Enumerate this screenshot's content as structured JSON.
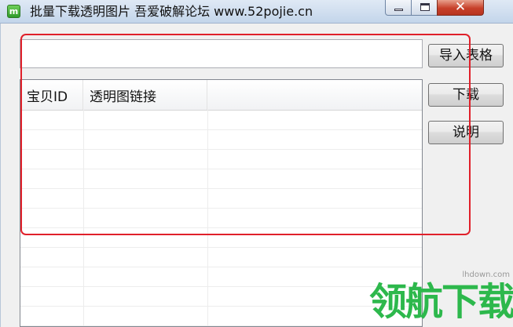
{
  "window": {
    "title": "批量下载透明图片  吾爱破解论坛  www.52pojie.cn",
    "icon": "app-icon",
    "controls": {
      "minimize": "minimize-icon",
      "maximize": "maximize-icon",
      "close": "✕"
    }
  },
  "form": {
    "file_path_value": "",
    "import_button_label": "导入表格",
    "download_button_label": "下载",
    "help_button_label": "说明"
  },
  "table": {
    "columns": [
      "宝贝ID",
      "透明图链接",
      ""
    ],
    "rows": []
  },
  "annotation": {
    "highlight_color": "#e0202a"
  },
  "watermark": {
    "url": "lhdown.com",
    "text": "领航下载",
    "color": "#2db84c"
  }
}
